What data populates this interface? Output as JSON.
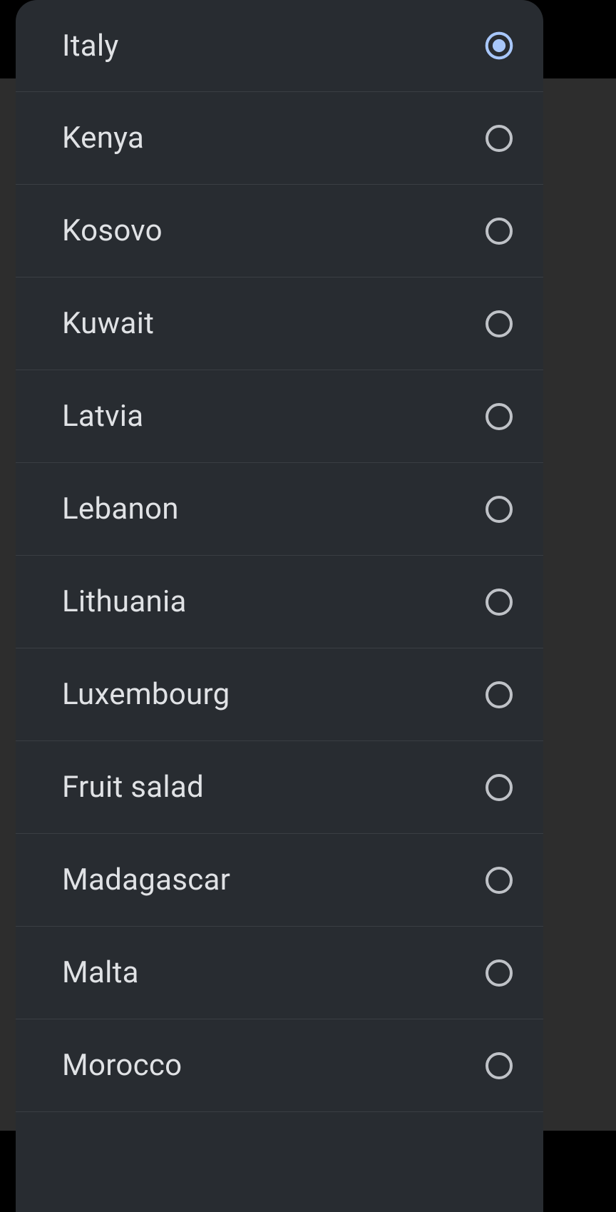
{
  "list": {
    "items": [
      {
        "label": "Italy",
        "selected": true
      },
      {
        "label": "Kenya",
        "selected": false
      },
      {
        "label": "Kosovo",
        "selected": false
      },
      {
        "label": "Kuwait",
        "selected": false
      },
      {
        "label": "Latvia",
        "selected": false
      },
      {
        "label": "Lebanon",
        "selected": false
      },
      {
        "label": "Lithuania",
        "selected": false
      },
      {
        "label": "Luxembourg",
        "selected": false
      },
      {
        "label": "Fruit salad",
        "selected": false
      },
      {
        "label": "Madagascar",
        "selected": false
      },
      {
        "label": "Malta",
        "selected": false
      },
      {
        "label": "Morocco",
        "selected": false
      }
    ]
  },
  "colors": {
    "dialog_bg": "#282c31",
    "text": "#e0e2e5",
    "radio_unselected": "#bfc2c7",
    "radio_selected": "#a8c7fa",
    "divider": "#3a3e43"
  }
}
